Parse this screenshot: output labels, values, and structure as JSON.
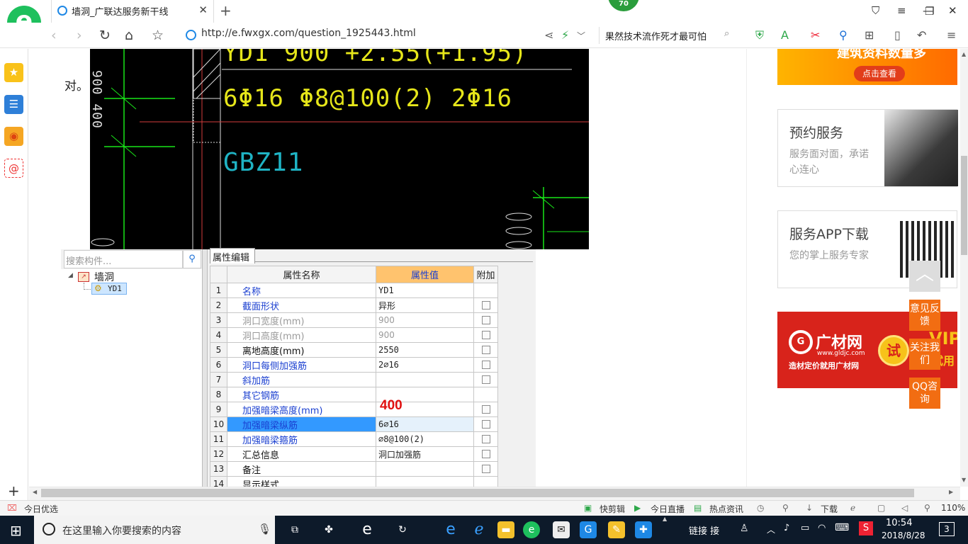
{
  "browser": {
    "tab_title": "墙洞_广联达服务新干线",
    "tab_badge": "70",
    "url": "http://e.fwxgx.com/question_1925443.html",
    "search_text": "果然技术流作死才最可怕"
  },
  "article": {
    "partial_text": "对。"
  },
  "cad": {
    "line1": "YD1 900 +2.55(+1.95)",
    "line2": "6Φ16  Φ8@100(2)  2Φ16",
    "label": "GBZ11",
    "left_digits": "900 400"
  },
  "app_panel": {
    "search_placeholder": "搜索构件...",
    "tree_root": "墙洞",
    "tree_child": "YD1",
    "tab_label": "属性编辑",
    "columns": [
      "属性名称",
      "属性值",
      "附加"
    ],
    "rows": [
      {
        "n": "1",
        "name": "名称",
        "value": "YD1"
      },
      {
        "n": "2",
        "name": "截面形状",
        "value": "异形"
      },
      {
        "n": "3",
        "name": "洞口宽度(mm)",
        "value": "900"
      },
      {
        "n": "4",
        "name": "洞口高度(mm)",
        "value": "900"
      },
      {
        "n": "5",
        "name": "离地高度(mm)",
        "value": "2550"
      },
      {
        "n": "6",
        "name": "洞口每侧加强筋",
        "value": "2⌀16"
      },
      {
        "n": "7",
        "name": "斜加筋",
        "value": ""
      },
      {
        "n": "8",
        "name": "其它钢筋",
        "value": ""
      },
      {
        "n": "9",
        "name": "加强暗梁高度(mm)",
        "value": ""
      },
      {
        "n": "10",
        "name": "加强暗梁纵筋",
        "value": "6⌀16"
      },
      {
        "n": "11",
        "name": "加强暗梁箍筋",
        "value": "⌀8@100(2)"
      },
      {
        "n": "12",
        "name": "汇总信息",
        "value": "洞口加强筋"
      },
      {
        "n": "13",
        "name": "备注",
        "value": ""
      },
      {
        "n": "14",
        "name": "显示样式",
        "value": ""
      }
    ],
    "annotation": "400"
  },
  "sidebar_right": {
    "banner_top": "建筑资料数量多",
    "banner_top_btn": "点击查看",
    "card1_title": "预约服务",
    "card1_sub": "服务面对面，承诺心连心",
    "card2_title": "服务APP下载",
    "card2_sub": "您的掌上服务专家",
    "ad_brand": "广材网",
    "ad_url": "www.gldjc.com",
    "ad_slogan": "造材定价就用广材网",
    "ad_try": "试",
    "ad_vip": "VIP",
    "ad_vip2": "试用",
    "float_feedback": "意见反馈",
    "float_follow": "关注我们",
    "float_qq": "QQ咨询"
  },
  "statusbar": {
    "left": "今日优选",
    "kuaijianji": "快剪辑",
    "live": "今日直播",
    "news": "热点资讯",
    "download": "下载",
    "zoom": "110%"
  },
  "taskbar": {
    "search_placeholder": "在这里输入你要搜索的内容",
    "tray_text": "链接 接",
    "time": "10:54",
    "date": "2018/8/28",
    "notif_count": "3"
  },
  "colors": {
    "accent_orange": "#f26d12",
    "grid_blue": "#1a3fd0",
    "annotation_red": "#e01010",
    "cad_yellow": "#e6e61a",
    "cad_cyan": "#1fb3c4",
    "cad_green": "#19e619"
  }
}
